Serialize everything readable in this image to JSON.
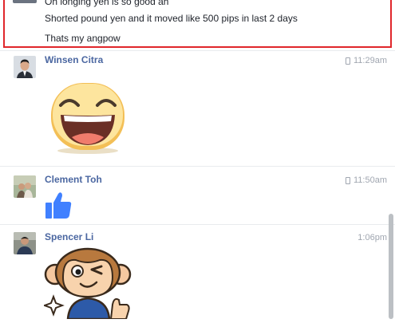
{
  "highlighted_messages": [
    "Oh longing yen is so good ah",
    "Shorted pound yen and it moved like 500 pips in last 2 days",
    "Thats my angpow"
  ],
  "messages": [
    {
      "sender": "Winsen Citra",
      "time": "11:29am",
      "device": "mobile",
      "content": "laughing-face-sticker"
    },
    {
      "sender": "Clement Toh",
      "time": "11:50am",
      "device": "mobile",
      "content": "thumbs-up-like"
    },
    {
      "sender": "Spencer Li",
      "time": "1:06pm",
      "device": "",
      "content": "monkey-wink-sticker"
    }
  ],
  "colors": {
    "highlight_border": "#e0272b",
    "sender_name": "#4b67a1",
    "like_blue": "#4080ff",
    "timestamp": "#a0a6b0"
  }
}
